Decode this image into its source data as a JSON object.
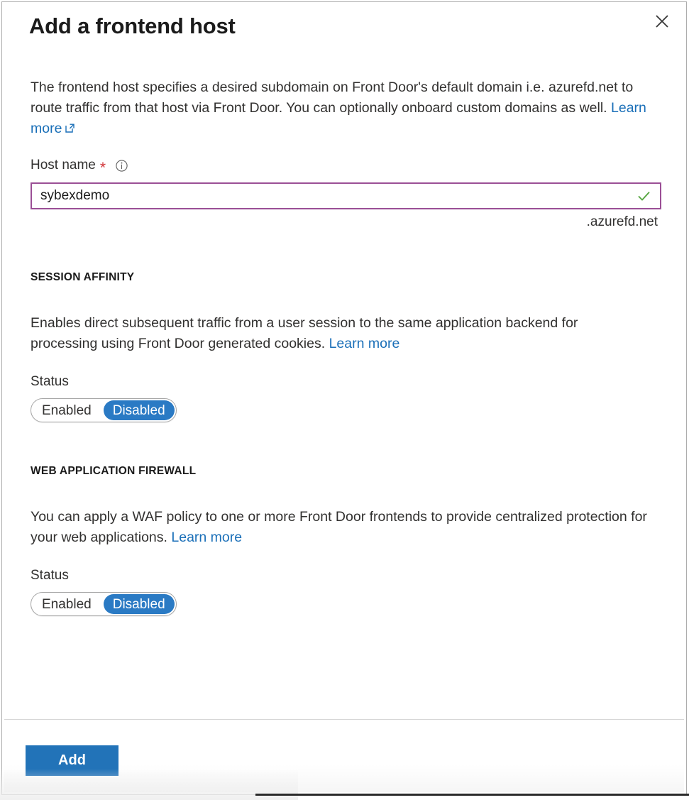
{
  "dialog": {
    "title": "Add a frontend host",
    "close_label": "Close",
    "close_icon": "close-icon",
    "description_part1": "The frontend host specifies a desired subdomain on Front Door's default domain i.e. azurefd.net to route traffic from that host via Front Door. You can optionally onboard custom domains as well. ",
    "description_link": "Learn more",
    "description_link_icon": "external-link-icon"
  },
  "host_name": {
    "label": "Host name",
    "required_marker": "*",
    "info_icon": "info-icon",
    "value": "sybexdemo",
    "placeholder": "",
    "validation_icon": "checkmark-icon",
    "suffix": ".azurefd.net",
    "border_color": "#9b4f96",
    "valid_color": "#5aa845"
  },
  "session_affinity": {
    "section_title": "SESSION AFFINITY",
    "body_text": "Enables direct subsequent traffic from a user session to the same application backend for processing using Front Door generated cookies. ",
    "body_link": "Learn more",
    "status_label": "Status",
    "options": [
      "Enabled",
      "Disabled"
    ],
    "selected": "Disabled"
  },
  "web_application_firewall": {
    "section_title": "WEB APPLICATION FIREWALL",
    "body_text": "You can apply a WAF policy to one or more Front Door frontends to provide centralized protection for your web applications. ",
    "body_link": "Learn more",
    "status_label": "Status",
    "options": [
      "Enabled",
      "Disabled"
    ],
    "selected": "Disabled"
  },
  "footer": {
    "add_label": "Add",
    "add_color": "#2273b8"
  },
  "colors": {
    "link": "#1a6fb8",
    "toggle_selected": "#2a7ac4",
    "required": "#d13438",
    "text": "#323130"
  }
}
